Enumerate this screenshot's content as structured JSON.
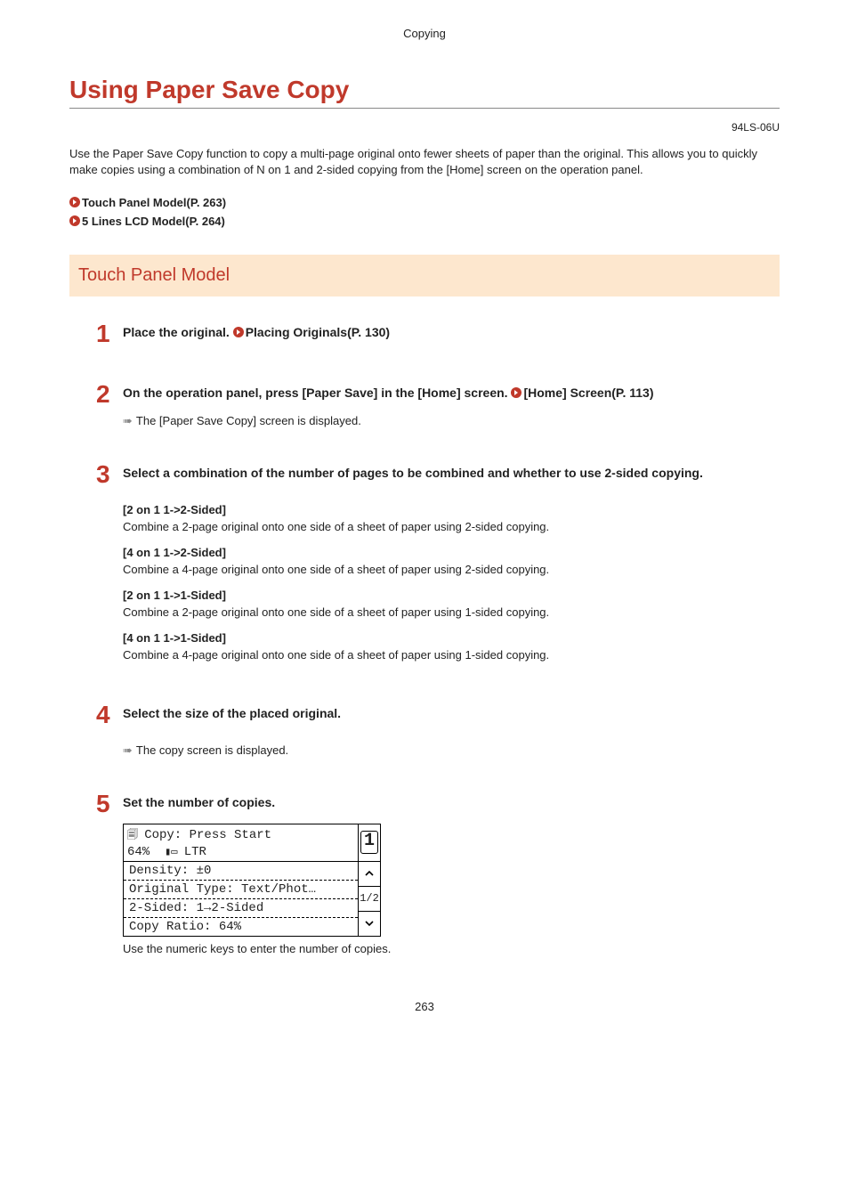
{
  "header": "Copying",
  "title": "Using Paper Save Copy",
  "doc_id": "94LS-06U",
  "intro": "Use the Paper Save Copy function to copy a multi-page original onto fewer sheets of paper than the original. This allows you to quickly make copies using a combination of N on 1 and 2-sided copying from the [Home] screen on the operation panel.",
  "links": {
    "touch": "Touch Panel Model(P. 263)",
    "lcd": "5 Lines LCD Model(P. 264)"
  },
  "section_title": "Touch Panel Model",
  "steps": {
    "s1": {
      "num": "1",
      "text_a": "Place the original. ",
      "link": "Placing Originals(P. 130)"
    },
    "s2": {
      "num": "2",
      "text_a": "On the operation panel, press [Paper Save] in the [Home] screen. ",
      "link": "[Home] Screen(P. 113)",
      "result": "The [Paper Save Copy] screen is displayed."
    },
    "s3": {
      "num": "3",
      "heading": "Select a combination of the number of pages to be combined and whether to use 2-sided copying.",
      "opts": [
        {
          "t": "[2 on 1 1->2-Sided]",
          "d": "Combine a 2-page original onto one side of a sheet of paper using 2-sided copying."
        },
        {
          "t": "[4 on 1 1->2-Sided]",
          "d": "Combine a 4-page original onto one side of a sheet of paper using 2-sided copying."
        },
        {
          "t": "[2 on 1 1->1-Sided]",
          "d": "Combine a 2-page original onto one side of a sheet of paper using 1-sided copying."
        },
        {
          "t": "[4 on 1 1->1-Sided]",
          "d": "Combine a 4-page original onto one side of a sheet of paper using 1-sided copying."
        }
      ]
    },
    "s4": {
      "num": "4",
      "heading": "Select the size of the placed original.",
      "result": "The copy screen is displayed."
    },
    "s5": {
      "num": "5",
      "heading": "Set the number of copies.",
      "caption": "Use the numeric keys to enter the number of copies."
    }
  },
  "lcd": {
    "title": "Copy: Press Start",
    "ratio_line": "64%",
    "paper_line": "LTR",
    "copies": "1",
    "items": [
      "Density: ±0",
      "Original Type: Text/Phot…",
      "2-Sided: 1→2-Sided",
      "Copy Ratio: 64%"
    ],
    "page_ind": "1/2"
  },
  "page_number": "263"
}
